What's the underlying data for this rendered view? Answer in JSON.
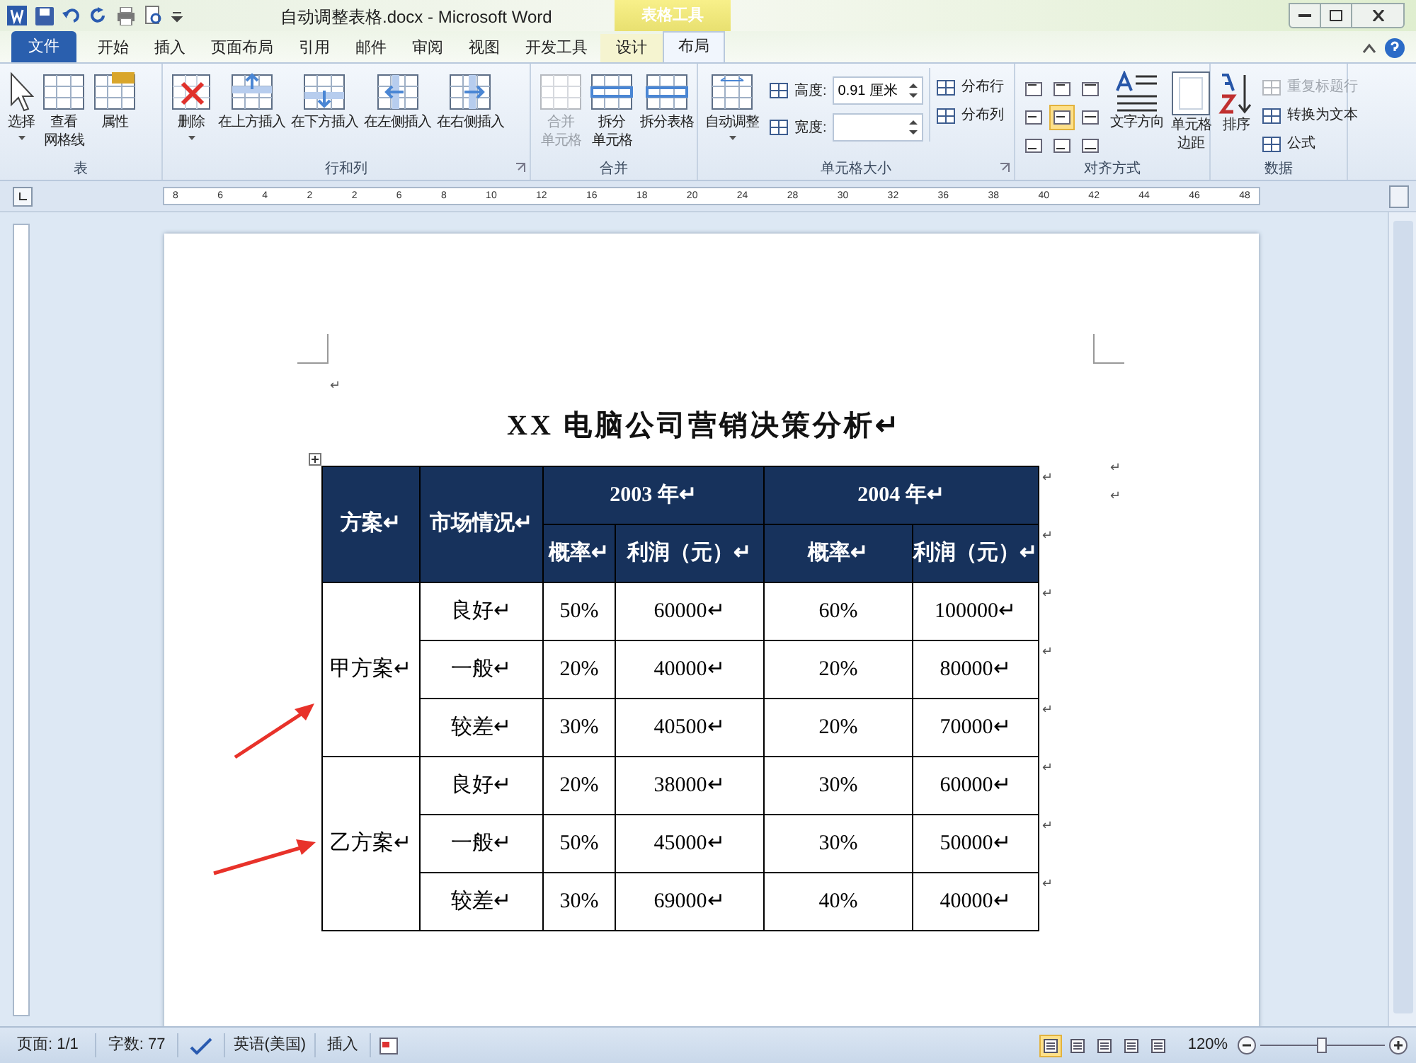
{
  "window": {
    "title": "自动调整表格.docx - Microsoft Word",
    "context_group": "表格工具"
  },
  "tabs": [
    {
      "label": "文件",
      "kind": "file",
      "selected": false
    },
    {
      "label": "开始",
      "kind": "tab",
      "selected": false
    },
    {
      "label": "插入",
      "kind": "tab",
      "selected": false
    },
    {
      "label": "页面布局",
      "kind": "tab",
      "selected": false
    },
    {
      "label": "引用",
      "kind": "tab",
      "selected": false
    },
    {
      "label": "邮件",
      "kind": "tab",
      "selected": false
    },
    {
      "label": "审阅",
      "kind": "tab",
      "selected": false
    },
    {
      "label": "视图",
      "kind": "tab",
      "selected": false
    },
    {
      "label": "开发工具",
      "kind": "tab",
      "selected": false
    },
    {
      "label": "设计",
      "kind": "context",
      "selected": false
    },
    {
      "label": "布局",
      "kind": "context",
      "selected": true
    }
  ],
  "ribbon": {
    "groups": [
      {
        "label": "表",
        "launcher": false,
        "items": [
          {
            "kind": "large",
            "lines": [
              "选择"
            ],
            "dropdown": true,
            "disabled": false
          },
          {
            "kind": "large",
            "lines": [
              "查看",
              "网格线"
            ],
            "dropdown": false,
            "disabled": false
          },
          {
            "kind": "large",
            "lines": [
              "属性"
            ],
            "dropdown": false,
            "disabled": false
          }
        ]
      },
      {
        "label": "行和列",
        "launcher": true,
        "items": [
          {
            "kind": "large",
            "lines": [
              "删除"
            ],
            "dropdown": true,
            "disabled": false
          },
          {
            "kind": "large",
            "lines": [
              "在上方插入"
            ],
            "dropdown": false,
            "disabled": false
          },
          {
            "kind": "large",
            "lines": [
              "在下方插入"
            ],
            "dropdown": false,
            "disabled": false
          },
          {
            "kind": "large",
            "lines": [
              "在左侧插入"
            ],
            "dropdown": false,
            "disabled": false
          },
          {
            "kind": "large",
            "lines": [
              "在右侧插入"
            ],
            "dropdown": false,
            "disabled": false
          }
        ]
      },
      {
        "label": "合并",
        "launcher": false,
        "items": [
          {
            "kind": "large",
            "lines": [
              "合并",
              "单元格"
            ],
            "dropdown": false,
            "disabled": true
          },
          {
            "kind": "large",
            "lines": [
              "拆分",
              "单元格"
            ],
            "dropdown": false,
            "disabled": false
          },
          {
            "kind": "large",
            "lines": [
              "拆分表格"
            ],
            "dropdown": false,
            "disabled": false
          }
        ]
      },
      {
        "label": "单元格大小",
        "launcher": true,
        "items": [
          {
            "kind": "large",
            "lines": [
              "自动调整"
            ],
            "dropdown": true,
            "disabled": false
          },
          {
            "kind": "fields",
            "fields": [
              {
                "label": "高度:",
                "value": "0.91 厘米"
              },
              {
                "label": "宽度:"
              }
            ]
          },
          {
            "kind": "smalls",
            "buttons": [
              {
                "label": "分布行",
                "disabled": false
              },
              {
                "label": "分布列",
                "disabled": false
              }
            ]
          }
        ]
      },
      {
        "label": "对齐方式",
        "launcher": false,
        "items": [
          {
            "kind": "align",
            "cells": [
              {
                "selected": false
              },
              {
                "selected": false
              },
              {
                "selected": false
              },
              {
                "selected": false
              },
              {
                "selected": true
              },
              {
                "selected": false
              },
              {
                "selected": false
              },
              {
                "selected": false
              },
              {
                "selected": false
              }
            ]
          },
          {
            "kind": "large",
            "lines": [
              "文字方向"
            ],
            "dropdown": false,
            "disabled": false
          },
          {
            "kind": "large",
            "lines": [
              "单元格",
              "边距"
            ],
            "dropdown": false,
            "disabled": false
          }
        ]
      },
      {
        "label": "数据",
        "launcher": false,
        "items": [
          {
            "kind": "large",
            "lines": [
              "排序"
            ],
            "dropdown": false,
            "disabled": false
          },
          {
            "kind": "smalls",
            "buttons": [
              {
                "label": "重复标题行",
                "disabled": true
              },
              {
                "label": "转换为文本",
                "disabled": false
              },
              {
                "label": "公式",
                "disabled": false
              }
            ]
          }
        ]
      }
    ]
  },
  "ruler": [
    "8",
    "6",
    "4",
    "2",
    "2",
    "6",
    "8",
    "10",
    "12",
    "16",
    "18",
    "20",
    "24",
    "28",
    "30",
    "32",
    "36",
    "38",
    "40",
    "42",
    "44",
    "46",
    "48"
  ],
  "document": {
    "empty_mark": "↵",
    "title": "XX 电脑公司营销决策分析↵",
    "side_marks": [
      "↵",
      "↵"
    ],
    "table": {
      "columns": [
        {
          "label": "方案↵"
        },
        {
          "label": "市场情况↵"
        },
        {
          "label": "2003 年↵",
          "sub": [
            "概率↵",
            "利润（元）↵"
          ]
        },
        {
          "label": "2004 年↵",
          "sub": [
            "概率↵",
            "利润（元）↵"
          ]
        }
      ],
      "header_row_marks": [
        "↵",
        "↵"
      ],
      "groups": [
        {
          "plan": "甲方案↵",
          "rows": [
            {
              "cells": [
                "良好↵",
                "50%",
                "60000↵",
                "60%",
                "100000↵"
              ],
              "end": "↵"
            },
            {
              "cells": [
                "一般↵",
                "20%",
                "40000↵",
                "20%",
                "80000↵"
              ],
              "end": "↵"
            },
            {
              "cells": [
                "较差↵",
                "30%",
                "40500↵",
                "20%",
                "70000↵"
              ],
              "end": "↵"
            }
          ]
        },
        {
          "plan": "乙方案↵",
          "rows": [
            {
              "cells": [
                "良好↵",
                "20%",
                "38000↵",
                "30%",
                "60000↵"
              ],
              "end": "↵"
            },
            {
              "cells": [
                "一般↵",
                "50%",
                "45000↵",
                "30%",
                "50000↵"
              ],
              "end": "↵"
            },
            {
              "cells": [
                "较差↵",
                "30%",
                "69000↵",
                "40%",
                "40000↵"
              ],
              "end": "↵"
            }
          ]
        }
      ]
    }
  },
  "status_bar": {
    "page": "页面: 1/1",
    "words": "字数: 77",
    "language": "英语(美国)",
    "mode": "插入",
    "views": [
      {
        "selected": true
      },
      {
        "selected": false
      },
      {
        "selected": false
      },
      {
        "selected": false
      },
      {
        "selected": false
      }
    ],
    "zoom": "120%",
    "zoom_slider": {
      "level": 0.5
    }
  }
}
